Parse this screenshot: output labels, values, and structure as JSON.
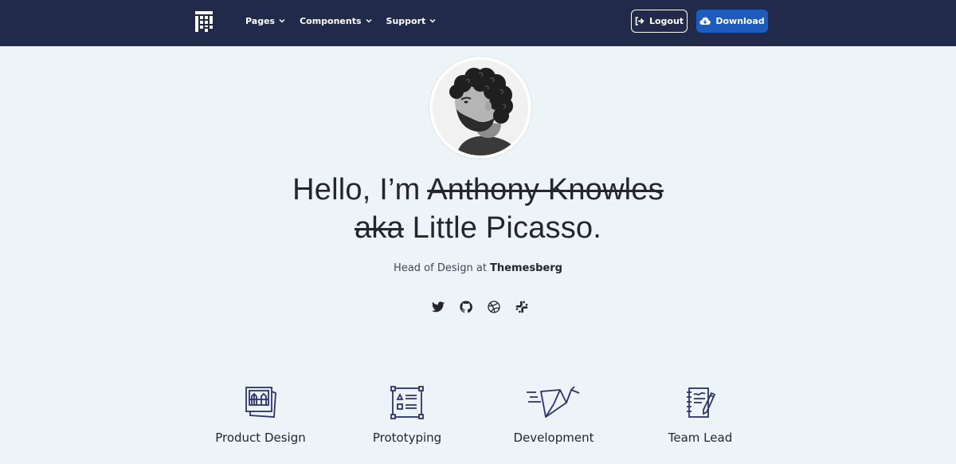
{
  "navbar": {
    "brand_icon": "pixel-logo-icon",
    "links": [
      {
        "label": "Pages",
        "icon": "chevron-down-icon"
      },
      {
        "label": "Components",
        "icon": "chevron-down-icon"
      },
      {
        "label": "Support",
        "icon": "chevron-down-icon"
      }
    ],
    "logout_label": "Logout",
    "logout_icon": "sign-out-icon",
    "download_label": "Download",
    "download_icon": "cloud-download-icon",
    "colors": {
      "navbar_bg": "#212a4a",
      "download_bg": "#1d5bbf"
    }
  },
  "hero": {
    "avatar_alt": "profile photo",
    "greeting": "Hello, I’m ",
    "struck_name": "Anthony Knowles",
    "struck_aka": "aka",
    "alias": " Little Picasso.",
    "role": "Head of Design at ",
    "company": "Themesberg",
    "socials": [
      {
        "name": "twitter",
        "icon": "twitter-icon"
      },
      {
        "name": "github",
        "icon": "github-icon"
      },
      {
        "name": "dribbble",
        "icon": "dribbble-icon"
      },
      {
        "name": "slack",
        "icon": "slack-icon"
      }
    ]
  },
  "skills": [
    {
      "label": "Product Design",
      "icon": "photo-frames-icon"
    },
    {
      "label": "Prototyping",
      "icon": "wireframe-icon"
    },
    {
      "label": "Development",
      "icon": "paper-crane-icon"
    },
    {
      "label": "Team Lead",
      "icon": "notebook-pen-icon"
    }
  ],
  "colors": {
    "page_bg": "#ecf4f8",
    "text": "#24262b",
    "icon_stroke": "#2c3270"
  }
}
